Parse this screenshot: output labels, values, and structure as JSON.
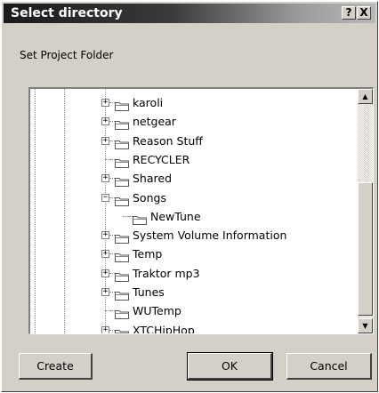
{
  "dialog": {
    "title": "Select directory",
    "help_label": "?",
    "close_label": "X",
    "prompt": "Set Project Folder"
  },
  "tree": {
    "items": [
      {
        "label": "karoli",
        "expander": "+",
        "indent": 0
      },
      {
        "label": "netgear",
        "expander": "+",
        "indent": 0
      },
      {
        "label": "Reason Stuff",
        "expander": "+",
        "indent": 0
      },
      {
        "label": "RECYCLER",
        "expander": "",
        "indent": 0
      },
      {
        "label": "Shared",
        "expander": "+",
        "indent": 0
      },
      {
        "label": "Songs",
        "expander": "−",
        "indent": 0
      },
      {
        "label": "NewTune",
        "expander": "",
        "indent": 1
      },
      {
        "label": "System Volume Information",
        "expander": "+",
        "indent": 0
      },
      {
        "label": "Temp",
        "expander": "+",
        "indent": 0
      },
      {
        "label": "Traktor mp3",
        "expander": "+",
        "indent": 0
      },
      {
        "label": "Tunes",
        "expander": "+",
        "indent": 0
      },
      {
        "label": "WUTemp",
        "expander": "",
        "indent": 0
      },
      {
        "label": "XTCHipHop",
        "expander": "+",
        "indent": 0
      }
    ]
  },
  "scrollbar": {
    "up_arrow": "▲",
    "down_arrow": "▼"
  },
  "buttons": {
    "create": "Create",
    "ok": "OK",
    "cancel": "Cancel"
  }
}
